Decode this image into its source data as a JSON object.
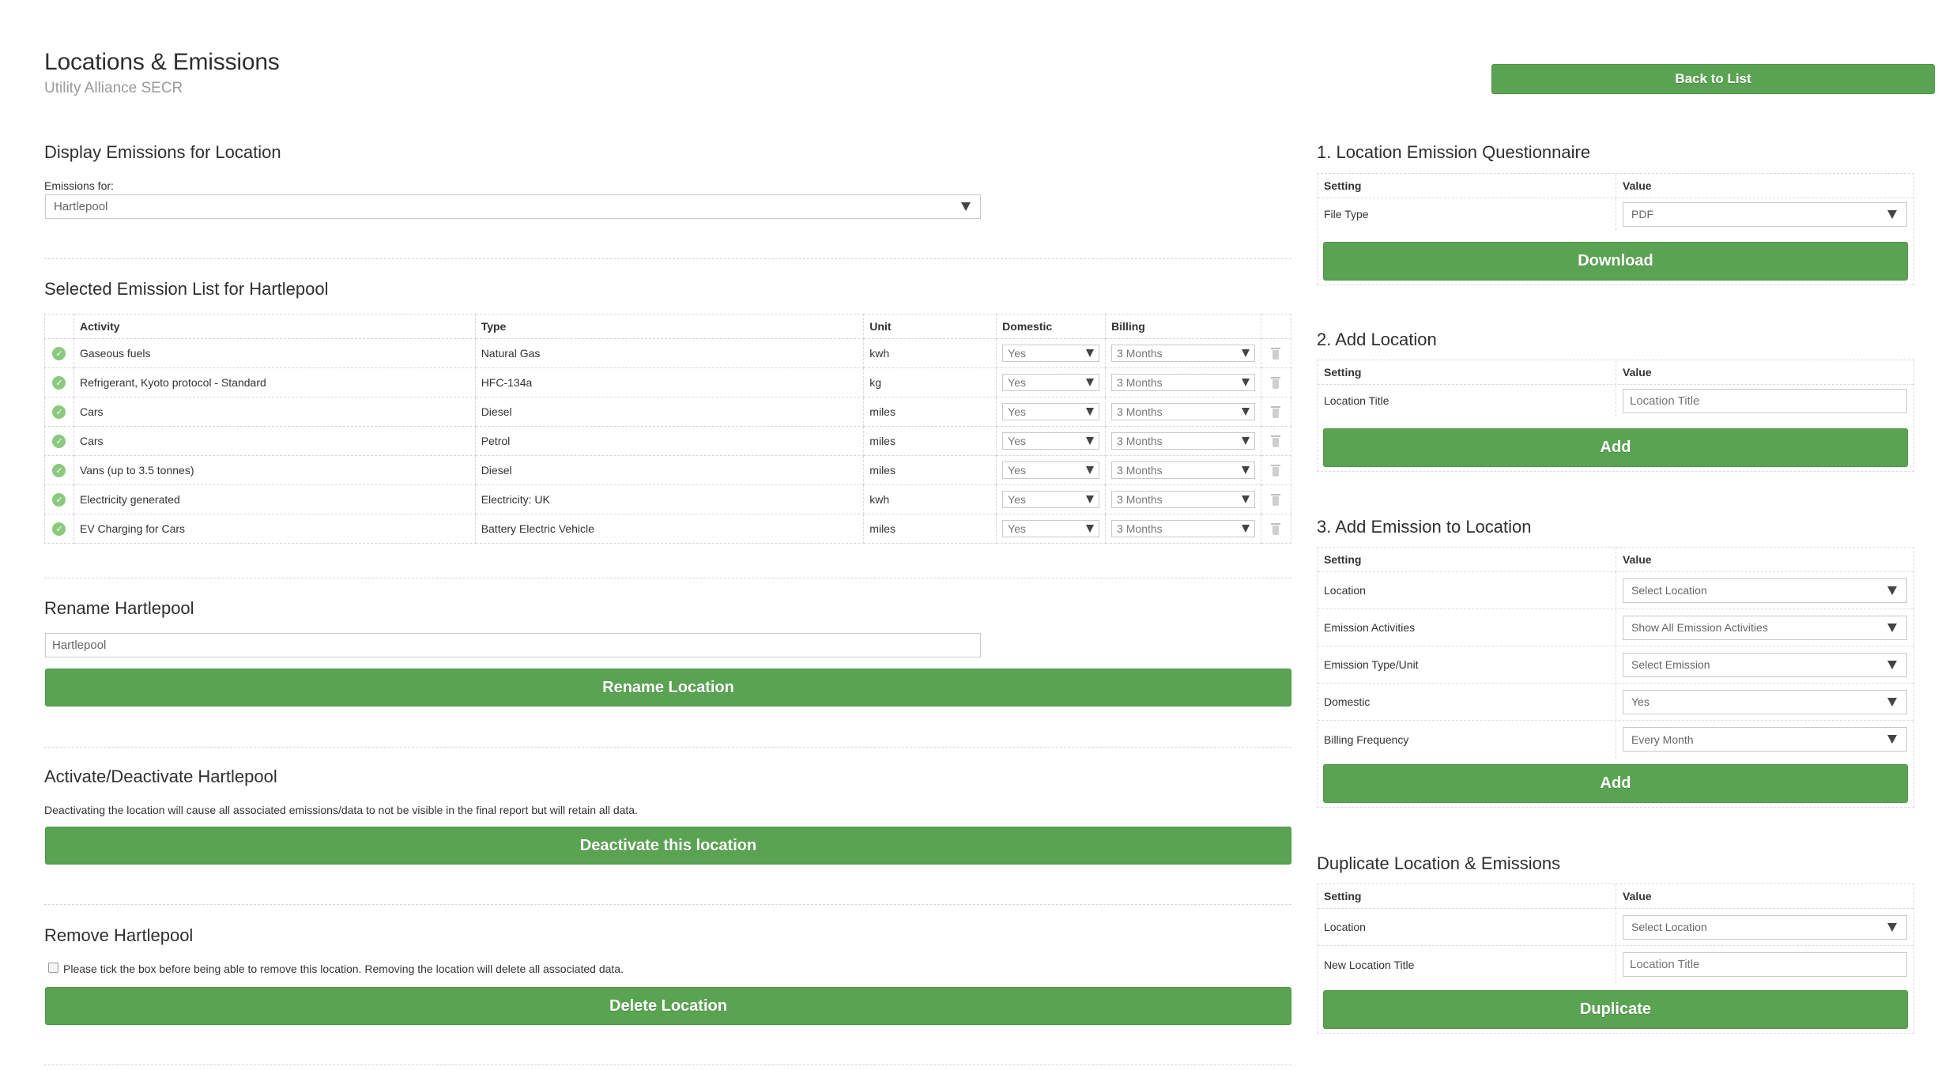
{
  "header": {
    "title": "Locations & Emissions",
    "subtitle": "Utility Alliance SECR",
    "back_button": "Back to List"
  },
  "display": {
    "title": "Display Emissions for Location",
    "label": "Emissions for:",
    "selected": "Hartlepool"
  },
  "emission_list": {
    "title": "Selected Emission List for Hartlepool",
    "columns": [
      "Activity",
      "Type",
      "Unit",
      "Domestic",
      "Billing"
    ],
    "rows": [
      {
        "activity": "Gaseous fuels",
        "type": "Natural Gas",
        "unit": "kwh",
        "domestic": "Yes",
        "billing": "3 Months"
      },
      {
        "activity": "Refrigerant, Kyoto protocol - Standard",
        "type": "HFC-134a",
        "unit": "kg",
        "domestic": "Yes",
        "billing": "3 Months"
      },
      {
        "activity": "Cars",
        "type": "Diesel",
        "unit": "miles",
        "domestic": "Yes",
        "billing": "3 Months"
      },
      {
        "activity": "Cars",
        "type": "Petrol",
        "unit": "miles",
        "domestic": "Yes",
        "billing": "3 Months"
      },
      {
        "activity": "Vans (up to 3.5 tonnes)",
        "type": "Diesel",
        "unit": "miles",
        "domestic": "Yes",
        "billing": "3 Months"
      },
      {
        "activity": "Electricity generated",
        "type": "Electricity: UK",
        "unit": "kwh",
        "domestic": "Yes",
        "billing": "3 Months"
      },
      {
        "activity": "EV Charging for Cars",
        "type": "Battery Electric Vehicle",
        "unit": "miles",
        "domestic": "Yes",
        "billing": "3 Months"
      }
    ]
  },
  "rename": {
    "title": "Rename Hartlepool",
    "value": "Hartlepool",
    "button": "Rename Location"
  },
  "activate": {
    "title": "Activate/Deactivate Hartlepool",
    "note": "Deactivating the location will cause all associated emissions/data to not be visible in the final report but will retain all data.",
    "button": "Deactivate this location"
  },
  "remove": {
    "title": "Remove Hartlepool",
    "note": "Please tick the box before being able to remove this location. Removing the location will delete all associated data.",
    "button": "Delete Location"
  },
  "questionnaire": {
    "title": "1. Location Emission Questionnaire",
    "setting_header": "Setting",
    "value_header": "Value",
    "file_type_label": "File Type",
    "file_type_value": "PDF",
    "button": "Download"
  },
  "add_location": {
    "title": "2. Add Location",
    "setting_header": "Setting",
    "value_header": "Value",
    "location_title_label": "Location Title",
    "location_title_placeholder": "Location Title",
    "button": "Add"
  },
  "add_emission": {
    "title": "3. Add Emission to Location",
    "setting_header": "Setting",
    "value_header": "Value",
    "location_label": "Location",
    "location_value": "Select Location",
    "activities_label": "Emission Activities",
    "activities_value": "Show All Emission Activities",
    "type_label": "Emission Type/Unit",
    "type_value": "Select Emission",
    "domestic_label": "Domestic",
    "domestic_value": "Yes",
    "billing_label": "Billing Frequency",
    "billing_value": "Every Month",
    "button": "Add"
  },
  "duplicate": {
    "title": "Duplicate Location & Emissions",
    "setting_header": "Setting",
    "value_header": "Value",
    "location_label": "Location",
    "location_value": "Select Location",
    "new_title_label": "New Location Title",
    "new_title_placeholder": "Location Title",
    "button": "Duplicate"
  },
  "colors": {
    "accent_green": "#5aa352",
    "check_green": "#8bc97f"
  }
}
